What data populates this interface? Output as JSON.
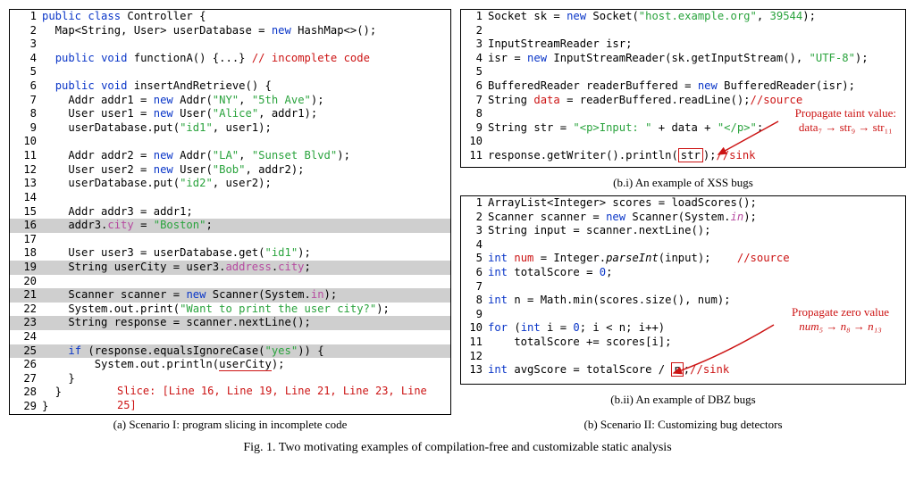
{
  "figure_caption": "Fig. 1.  Two motivating examples of compilation-free and customizable static analysis",
  "scenarioA": {
    "caption": "(a) Scenario I: program slicing in incomplete code",
    "slice_note": "Slice: [Line 16, Line 19, Line 21, Line 23, Line 25]",
    "lines": [
      {
        "n": 1,
        "hl": false,
        "tokens": [
          [
            "kw",
            "public"
          ],
          [
            "nm",
            " "
          ],
          [
            "kw",
            "class"
          ],
          [
            "nm",
            " Controller {"
          ]
        ]
      },
      {
        "n": 2,
        "hl": false,
        "tokens": [
          [
            "nm",
            "  Map<String, User> userDatabase = "
          ],
          [
            "kw",
            "new"
          ],
          [
            "nm",
            " HashMap<>();"
          ]
        ]
      },
      {
        "n": 3,
        "hl": false,
        "tokens": [
          [
            "nm",
            ""
          ]
        ]
      },
      {
        "n": 4,
        "hl": false,
        "tokens": [
          [
            "nm",
            "  "
          ],
          [
            "kw",
            "public"
          ],
          [
            "nm",
            " "
          ],
          [
            "kw",
            "void"
          ],
          [
            "nm",
            " functionA() {...} "
          ],
          [
            "cm",
            "// incomplete code"
          ]
        ]
      },
      {
        "n": 5,
        "hl": false,
        "tokens": [
          [
            "nm",
            ""
          ]
        ]
      },
      {
        "n": 6,
        "hl": false,
        "tokens": [
          [
            "nm",
            "  "
          ],
          [
            "kw",
            "public"
          ],
          [
            "nm",
            " "
          ],
          [
            "kw",
            "void"
          ],
          [
            "nm",
            " insertAndRetrieve() {"
          ]
        ]
      },
      {
        "n": 7,
        "hl": false,
        "tokens": [
          [
            "nm",
            "    Addr addr1 = "
          ],
          [
            "kw",
            "new"
          ],
          [
            "nm",
            " Addr("
          ],
          [
            "str",
            "\"NY\""
          ],
          [
            "nm",
            ", "
          ],
          [
            "str",
            "\"5th Ave\""
          ],
          [
            "nm",
            ");"
          ]
        ]
      },
      {
        "n": 8,
        "hl": false,
        "tokens": [
          [
            "nm",
            "    User user1 = "
          ],
          [
            "kw",
            "new"
          ],
          [
            "nm",
            " User("
          ],
          [
            "str",
            "\"Alice\""
          ],
          [
            "nm",
            ", addr1);"
          ]
        ]
      },
      {
        "n": 9,
        "hl": false,
        "tokens": [
          [
            "nm",
            "    userDatabase.put("
          ],
          [
            "str",
            "\"id1\""
          ],
          [
            "nm",
            ", user1);"
          ]
        ]
      },
      {
        "n": 10,
        "hl": false,
        "tokens": [
          [
            "nm",
            ""
          ]
        ]
      },
      {
        "n": 11,
        "hl": false,
        "tokens": [
          [
            "nm",
            "    Addr addr2 = "
          ],
          [
            "kw",
            "new"
          ],
          [
            "nm",
            " Addr("
          ],
          [
            "str",
            "\"LA\""
          ],
          [
            "nm",
            ", "
          ],
          [
            "str",
            "\"Sunset Blvd\""
          ],
          [
            "nm",
            ");"
          ]
        ]
      },
      {
        "n": 12,
        "hl": false,
        "tokens": [
          [
            "nm",
            "    User user2 = "
          ],
          [
            "kw",
            "new"
          ],
          [
            "nm",
            " User("
          ],
          [
            "str",
            "\"Bob\""
          ],
          [
            "nm",
            ", addr2);"
          ]
        ]
      },
      {
        "n": 13,
        "hl": false,
        "tokens": [
          [
            "nm",
            "    userDatabase.put("
          ],
          [
            "str",
            "\"id2\""
          ],
          [
            "nm",
            ", user2);"
          ]
        ]
      },
      {
        "n": 14,
        "hl": false,
        "tokens": [
          [
            "nm",
            ""
          ]
        ]
      },
      {
        "n": 15,
        "hl": false,
        "tokens": [
          [
            "nm",
            "    Addr addr3 = addr1;"
          ]
        ]
      },
      {
        "n": 16,
        "hl": true,
        "tokens": [
          [
            "nm",
            "    addr3."
          ],
          [
            "fld",
            "city"
          ],
          [
            "nm",
            " = "
          ],
          [
            "str",
            "\"Boston\""
          ],
          [
            "nm",
            ";"
          ]
        ]
      },
      {
        "n": 17,
        "hl": false,
        "tokens": [
          [
            "nm",
            ""
          ]
        ]
      },
      {
        "n": 18,
        "hl": false,
        "tokens": [
          [
            "nm",
            "    User user3 = userDatabase.get("
          ],
          [
            "str",
            "\"id1\""
          ],
          [
            "nm",
            ");"
          ]
        ]
      },
      {
        "n": 19,
        "hl": true,
        "tokens": [
          [
            "nm",
            "    String userCity = user3."
          ],
          [
            "fld",
            "address"
          ],
          [
            "nm",
            "."
          ],
          [
            "fld",
            "city"
          ],
          [
            "nm",
            ";"
          ]
        ]
      },
      {
        "n": 20,
        "hl": false,
        "tokens": [
          [
            "nm",
            ""
          ]
        ]
      },
      {
        "n": 21,
        "hl": true,
        "tokens": [
          [
            "nm",
            "    Scanner scanner = "
          ],
          [
            "kw",
            "new"
          ],
          [
            "nm",
            " Scanner(System."
          ],
          [
            "fld",
            "in"
          ],
          [
            "nm",
            ");"
          ]
        ]
      },
      {
        "n": 22,
        "hl": false,
        "tokens": [
          [
            "nm",
            "    System.out.print("
          ],
          [
            "str",
            "\"Want to print the user city?\""
          ],
          [
            "nm",
            ");"
          ]
        ]
      },
      {
        "n": 23,
        "hl": true,
        "tokens": [
          [
            "nm",
            "    String response = scanner.nextLine();"
          ]
        ]
      },
      {
        "n": 24,
        "hl": false,
        "tokens": [
          [
            "nm",
            ""
          ]
        ]
      },
      {
        "n": 25,
        "hl": true,
        "tokens": [
          [
            "nm",
            "    "
          ],
          [
            "kw",
            "if"
          ],
          [
            "nm",
            " (response.equalsIgnoreCase("
          ],
          [
            "str",
            "\"yes\""
          ],
          [
            "nm",
            ")) {"
          ]
        ]
      },
      {
        "n": 26,
        "hl": false,
        "tokens": [
          [
            "nm",
            "        System.out.println("
          ],
          [
            "under-red",
            "userCity"
          ],
          [
            "nm",
            ");"
          ]
        ]
      },
      {
        "n": 27,
        "hl": false,
        "tokens": [
          [
            "nm",
            "    }"
          ]
        ]
      },
      {
        "n": 28,
        "hl": false,
        "tokens": [
          [
            "nm",
            "  }"
          ]
        ]
      },
      {
        "n": 29,
        "hl": false,
        "tokens": [
          [
            "nm",
            "}"
          ]
        ]
      }
    ]
  },
  "scenarioB": {
    "caption": "(b) Scenario II: Customizing bug detectors",
    "bi": {
      "caption": "(b.i) An example of XSS bugs",
      "annot": "Propagate taint value:",
      "annot2": "data₇ → str₉ → str₁₁",
      "lines": [
        {
          "n": 1,
          "tokens": [
            [
              "nm",
              "Socket sk = "
            ],
            [
              "kw",
              "new"
            ],
            [
              "nm",
              " Socket("
            ],
            [
              "str",
              "\"host.example.org\""
            ],
            [
              "nm",
              ", "
            ],
            [
              "green",
              "39544"
            ],
            [
              "nm",
              ");"
            ]
          ]
        },
        {
          "n": 2,
          "tokens": [
            [
              "nm",
              ""
            ]
          ]
        },
        {
          "n": 3,
          "tokens": [
            [
              "nm",
              "InputStreamReader isr;"
            ]
          ]
        },
        {
          "n": 4,
          "tokens": [
            [
              "nm",
              "isr = "
            ],
            [
              "kw",
              "new"
            ],
            [
              "nm",
              " InputStreamReader(sk.getInputStream(), "
            ],
            [
              "str",
              "\"UTF-8\""
            ],
            [
              "nm",
              ");"
            ]
          ]
        },
        {
          "n": 5,
          "tokens": [
            [
              "nm",
              ""
            ]
          ]
        },
        {
          "n": 6,
          "tokens": [
            [
              "nm",
              "BufferedReader readerBuffered = "
            ],
            [
              "kw",
              "new"
            ],
            [
              "nm",
              " BufferedReader(isr);"
            ]
          ]
        },
        {
          "n": 7,
          "tokens": [
            [
              "nm",
              "String "
            ],
            [
              "red",
              "data"
            ],
            [
              "nm",
              " = readerBuffered.readLine();"
            ],
            [
              "cm",
              "//source"
            ]
          ]
        },
        {
          "n": 8,
          "tokens": [
            [
              "nm",
              ""
            ]
          ]
        },
        {
          "n": 9,
          "tokens": [
            [
              "nm",
              "String str = "
            ],
            [
              "str",
              "\"<p>Input: \""
            ],
            [
              "nm",
              " + data + "
            ],
            [
              "str",
              "\"</p>\""
            ],
            [
              "nm",
              ";"
            ]
          ]
        },
        {
          "n": 10,
          "tokens": [
            [
              "nm",
              ""
            ]
          ]
        },
        {
          "n": 11,
          "tokens": [
            [
              "nm",
              "response.getWriter().println("
            ],
            [
              "boxed-red",
              "str"
            ],
            [
              "nm",
              ");"
            ],
            [
              "cm",
              "//sink"
            ]
          ]
        }
      ]
    },
    "bii": {
      "caption": "(b.ii) An example of DBZ bugs",
      "annot": "Propagate zero value",
      "annot2": "num₅ → n₈ → n₁₃",
      "lines": [
        {
          "n": 1,
          "tokens": [
            [
              "nm",
              "ArrayList<Integer> scores = loadScores();"
            ]
          ]
        },
        {
          "n": 2,
          "tokens": [
            [
              "nm",
              "Scanner scanner = "
            ],
            [
              "kw",
              "new"
            ],
            [
              "nm",
              " Scanner(System."
            ],
            [
              "fld italic",
              "in"
            ],
            [
              "nm",
              ");"
            ]
          ]
        },
        {
          "n": 3,
          "tokens": [
            [
              "nm",
              "String input = scanner.nextLine();"
            ]
          ]
        },
        {
          "n": 4,
          "tokens": [
            [
              "nm",
              ""
            ]
          ]
        },
        {
          "n": 5,
          "tokens": [
            [
              "kw",
              "int"
            ],
            [
              "nm",
              " "
            ],
            [
              "red",
              "num"
            ],
            [
              "nm",
              " = Integer."
            ],
            [
              "italic",
              "parseInt"
            ],
            [
              "nm",
              "(input);    "
            ],
            [
              "cm",
              "//source"
            ]
          ]
        },
        {
          "n": 6,
          "tokens": [
            [
              "kw",
              "int"
            ],
            [
              "nm",
              " totalScore = "
            ],
            [
              "blue",
              "0"
            ],
            [
              "nm",
              ";"
            ]
          ]
        },
        {
          "n": 7,
          "tokens": [
            [
              "nm",
              ""
            ]
          ]
        },
        {
          "n": 8,
          "tokens": [
            [
              "kw",
              "int"
            ],
            [
              "nm",
              " n = Math.min(scores.size(), num);"
            ]
          ]
        },
        {
          "n": 9,
          "tokens": [
            [
              "nm",
              ""
            ]
          ]
        },
        {
          "n": 10,
          "tokens": [
            [
              "kw",
              "for"
            ],
            [
              "nm",
              " ("
            ],
            [
              "kw",
              "int"
            ],
            [
              "nm",
              " i = "
            ],
            [
              "blue",
              "0"
            ],
            [
              "nm",
              "; i < n; i++)"
            ]
          ]
        },
        {
          "n": 11,
          "tokens": [
            [
              "nm",
              "    totalScore += scores[i];"
            ]
          ]
        },
        {
          "n": 12,
          "tokens": [
            [
              "nm",
              ""
            ]
          ]
        },
        {
          "n": 13,
          "tokens": [
            [
              "kw",
              "int"
            ],
            [
              "nm",
              " avgScore = totalScore / "
            ],
            [
              "boxed-red",
              "n"
            ],
            [
              "nm",
              ";"
            ],
            [
              "cm",
              "//sink"
            ]
          ]
        }
      ]
    }
  }
}
